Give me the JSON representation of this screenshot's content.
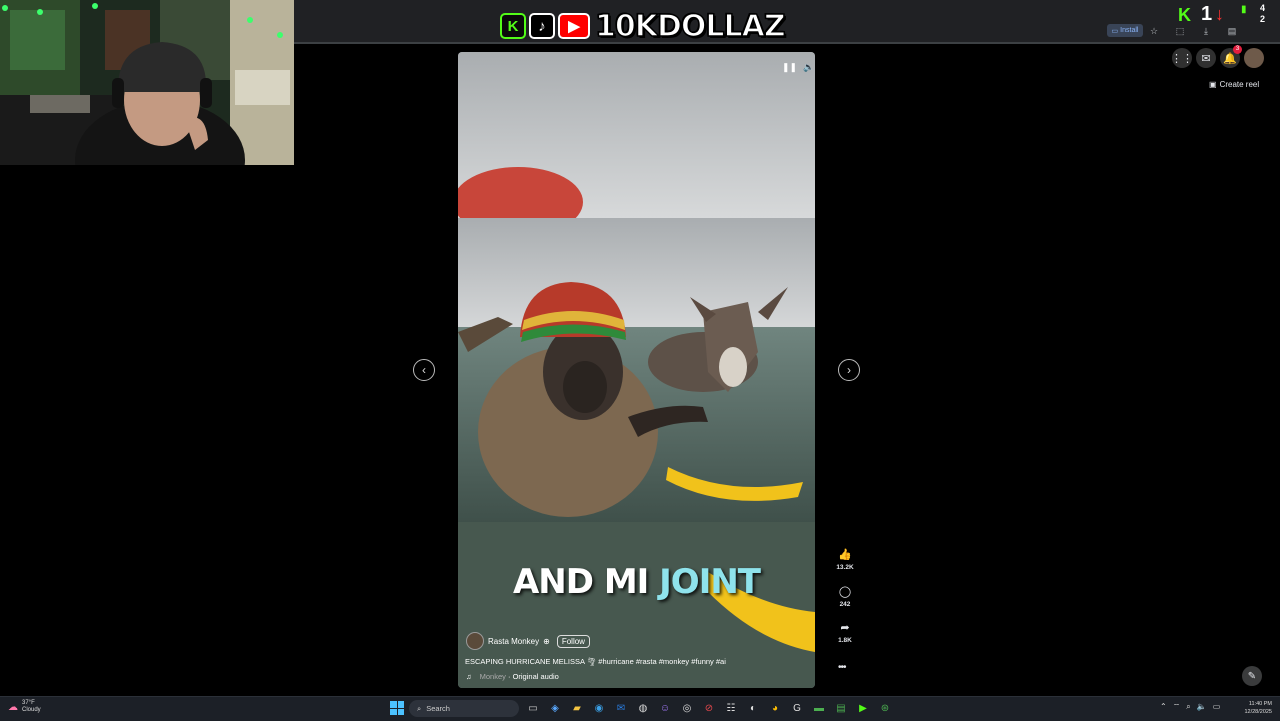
{
  "stream_overlay": {
    "channel_name": "10KDOLLAZ",
    "counter_main": "1",
    "counter_small_top": "4",
    "counter_small_bottom": "2"
  },
  "browser": {
    "install_label": "Install"
  },
  "facebook": {
    "create_reel_label": "Create reel",
    "notification_count": "3"
  },
  "reel": {
    "caption_word1": "AND MI",
    "caption_word2": "JOINT",
    "owner_name": "Rasta Monkey",
    "follow_label": "Follow",
    "description": "ESCAPING HURRICANE MELISSA 🌪 #hurricane #rasta #monkey #funny #ai",
    "audio_owner": "Monkey",
    "audio_label": "Original audio",
    "likes": "13.2K",
    "comments": "242",
    "shares": "1.8K"
  },
  "taskbar": {
    "weather_temp": "37°F",
    "weather_desc": "Cloudy",
    "search_placeholder": "Search",
    "time": "11:40 PM",
    "date": "12/28/2025"
  },
  "colors": {
    "caption_highlight": "#8fe3ec",
    "page_bg": "#000000",
    "taskbar_bg": "#1c2027",
    "kick_green": "#53fc18",
    "youtube_red": "#ff0000"
  }
}
